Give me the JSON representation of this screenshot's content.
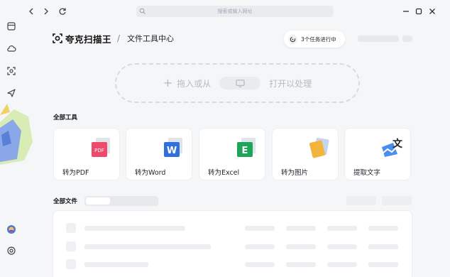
{
  "app": {
    "brand_name": "夸克扫描王",
    "separator": "/",
    "page_title": "文件工具中心"
  },
  "topbar": {
    "search_placeholder": "搜索或输入网址"
  },
  "tasks": {
    "label": "3个任务进行中"
  },
  "dropzone": {
    "plus": "+",
    "text_left": "拖入或从",
    "text_right": "打开以处理"
  },
  "tools_section": {
    "title": "全部工具",
    "items": [
      {
        "label": "转为PDF",
        "icon": "pdf-icon",
        "color": "#ef4a6b"
      },
      {
        "label": "转为Word",
        "icon": "word-icon",
        "color": "#2f6fe0"
      },
      {
        "label": "转为Excel",
        "icon": "excel-icon",
        "color": "#1fa55a"
      },
      {
        "label": "转为图片",
        "icon": "image-icon",
        "color": "#f3b43d"
      },
      {
        "label": "提取文字",
        "icon": "text-extract-icon",
        "color": "#4a8ff0"
      }
    ]
  },
  "files_section": {
    "title": "全部文件"
  },
  "colors": {
    "background": "#f5f6f8",
    "card": "#ffffff",
    "placeholder": "#e7e9ed"
  }
}
